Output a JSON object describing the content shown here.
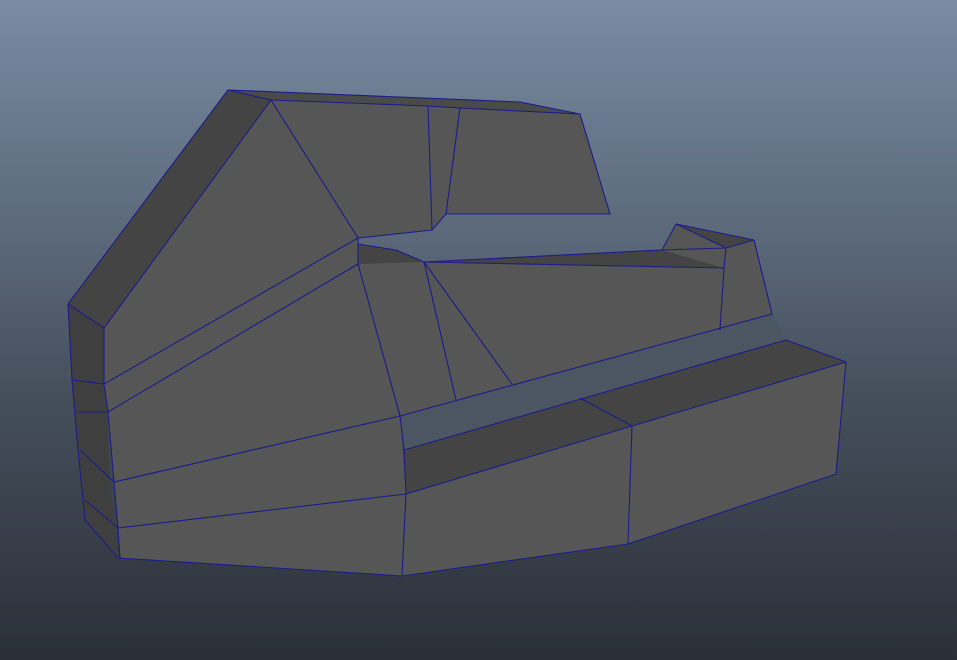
{
  "viewport": {
    "background_top": "#7a8ba2",
    "background_bottom": "#2b3038",
    "wireframe_color": "#1c1c8a",
    "mesh_color": "#555555"
  }
}
